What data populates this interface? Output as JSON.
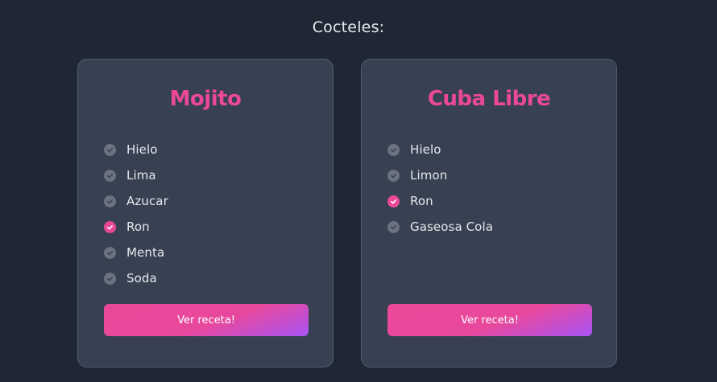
{
  "page": {
    "title": "Cocteles:"
  },
  "colors": {
    "background": "#1f2735",
    "card": "#384152",
    "accent": "#ec4899",
    "check_off": "#6b7280",
    "gradient_end": "#a855f7"
  },
  "cards": [
    {
      "title": "Mojito",
      "ingredients": [
        {
          "name": "Hielo",
          "checked": false,
          "icon": "check-circle-icon"
        },
        {
          "name": "Lima",
          "checked": false,
          "icon": "check-circle-icon"
        },
        {
          "name": "Azucar",
          "checked": false,
          "icon": "check-circle-icon"
        },
        {
          "name": "Ron",
          "checked": true,
          "icon": "check-circle-icon"
        },
        {
          "name": "Menta",
          "checked": false,
          "icon": "check-circle-icon"
        },
        {
          "name": "Soda",
          "checked": false,
          "icon": "check-circle-icon"
        }
      ],
      "button_label": "Ver receta!"
    },
    {
      "title": "Cuba Libre",
      "ingredients": [
        {
          "name": "Hielo",
          "checked": false,
          "icon": "check-circle-icon"
        },
        {
          "name": "Limon",
          "checked": false,
          "icon": "check-circle-icon"
        },
        {
          "name": "Ron",
          "checked": true,
          "icon": "check-circle-icon"
        },
        {
          "name": "Gaseosa Cola",
          "checked": false,
          "icon": "check-circle-icon"
        }
      ],
      "button_label": "Ver receta!"
    }
  ]
}
